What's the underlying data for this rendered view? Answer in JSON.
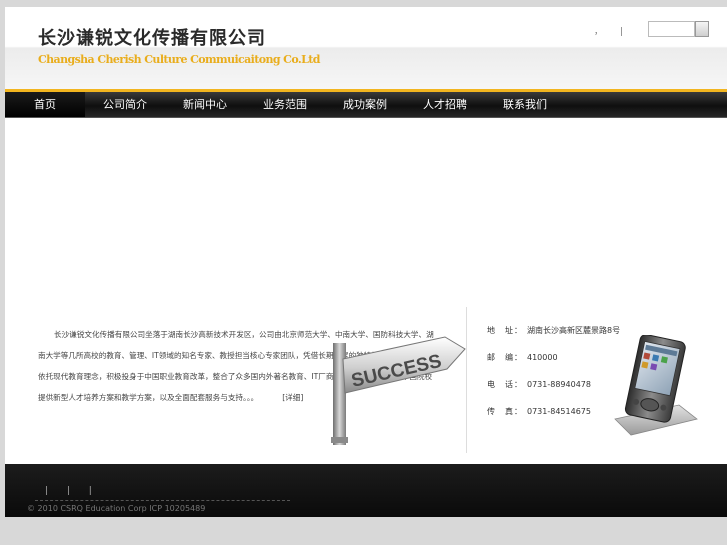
{
  "header": {
    "company_cn": "长沙谦锐文化传播有限公司",
    "company_en": "Changsha Cherish Culture Commuicaitong Co.Ltd",
    "top_links": [
      "，",
      "|"
    ],
    "search": {
      "value": ""
    }
  },
  "nav": {
    "items": [
      {
        "label": "首页",
        "active": true
      },
      {
        "label": "公司简介"
      },
      {
        "label": "新闻中心"
      },
      {
        "label": "业务范围"
      },
      {
        "label": "成功案例"
      },
      {
        "label": "人才招聘"
      },
      {
        "label": "联系我们"
      }
    ]
  },
  "intro": {
    "text": "长沙谦锐文化传播有限公司坐落于湖南长沙高新技术开发区，公司由北京师范大学、中南大学、国防科技大学、湖南大学等几所高校的教育、管理、IT领域的知名专家、教授担当核心专家团队，凭借长期积累的独特技术和资源优势，依托现代教育理念，积极投身于中国职业教育改革，整合了众多国内外著名教育、IT厂商的优质教育资源，为中国院校提供新型人才培养方案和教学方案，以及全面配套服务与支持。。。",
    "more_label": "[详细]",
    "sign_text": "SUCCESS"
  },
  "contact": {
    "rows": [
      {
        "label": "地　址：",
        "value": "湖南长沙高新区麓景路8号"
      },
      {
        "label": "邮　编：",
        "value": "410000"
      },
      {
        "label": "电　话：",
        "value": "0731-88940478"
      },
      {
        "label": "传　真：",
        "value": "0731-84514675"
      }
    ]
  },
  "footer": {
    "links": "| | |",
    "copyright": "© 2010 CSRQ Education Corp ICP  10205489"
  },
  "colors": {
    "accent": "#f2b51f",
    "nav_bg": "#1a1a1a",
    "footer_bg": "#111111"
  }
}
